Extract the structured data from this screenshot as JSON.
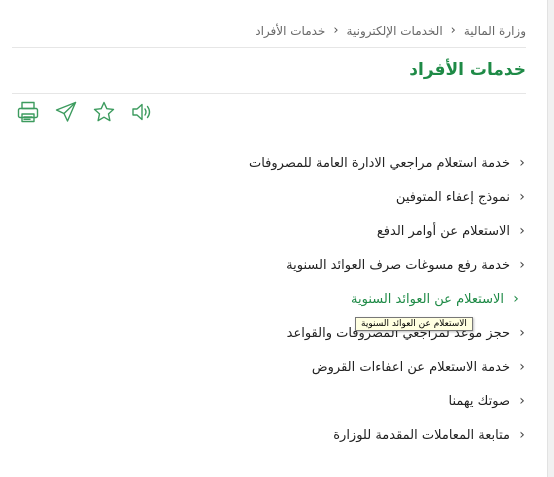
{
  "breadcrumb": {
    "items": [
      "وزارة المالية",
      "الخدمات الإلكترونية",
      "خدمات الأفراد"
    ],
    "separator": "‹"
  },
  "page": {
    "title": "خدمات الأفراد",
    "accent_color": "#1e8a46"
  },
  "toolbar": {
    "icons": [
      "speaker-icon",
      "star-icon",
      "send-icon",
      "print-icon"
    ]
  },
  "services": {
    "chevron": "‹",
    "items": [
      "خدمة استعلام مراجعي الادارة العامة للمصروفات",
      "نموذج إعفاء المتوفين",
      "الاستعلام عن أوامر الدفع",
      "خدمة رفع مسوغات صرف العوائد السنوية",
      "الاستعلام عن العوائد السنوية",
      "حجز موعد لمراجعي المصروفات والقواعد",
      "خدمة الاستعلام عن اعفاءات القروض",
      "صوتك يهمنا",
      "متابعة المعاملات المقدمة للوزارة"
    ]
  },
  "tooltip": {
    "text": "الاستعلام عن العوائد السنوية"
  }
}
